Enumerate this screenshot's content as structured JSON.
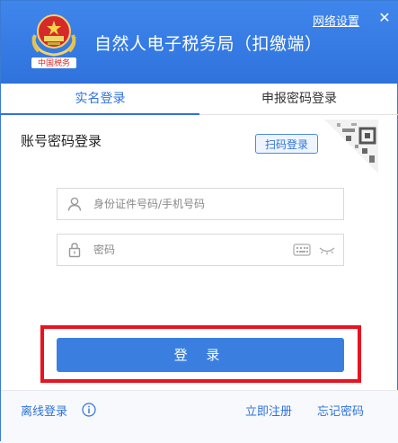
{
  "header": {
    "app_title": "自然人电子税务局（扣缴端）",
    "network_settings": "网络设置",
    "emblem_text": "中国税务"
  },
  "tabs": [
    {
      "label": "实名登录",
      "active": true
    },
    {
      "label": "申报密码登录",
      "active": false
    }
  ],
  "form": {
    "section_title": "账号密码登录",
    "scan_login": "扫码登录",
    "id_placeholder": "身份证件号码/手机号码",
    "id_value": "",
    "password_placeholder": "密码",
    "password_value": ""
  },
  "login_button": "登 录",
  "footer": {
    "offline_login": "离线登录",
    "register": "立即注册",
    "forgot_password": "忘记密码"
  },
  "colors": {
    "primary": "#2f72dc",
    "button": "#3a7fe0",
    "highlight_box": "#e8131f"
  }
}
